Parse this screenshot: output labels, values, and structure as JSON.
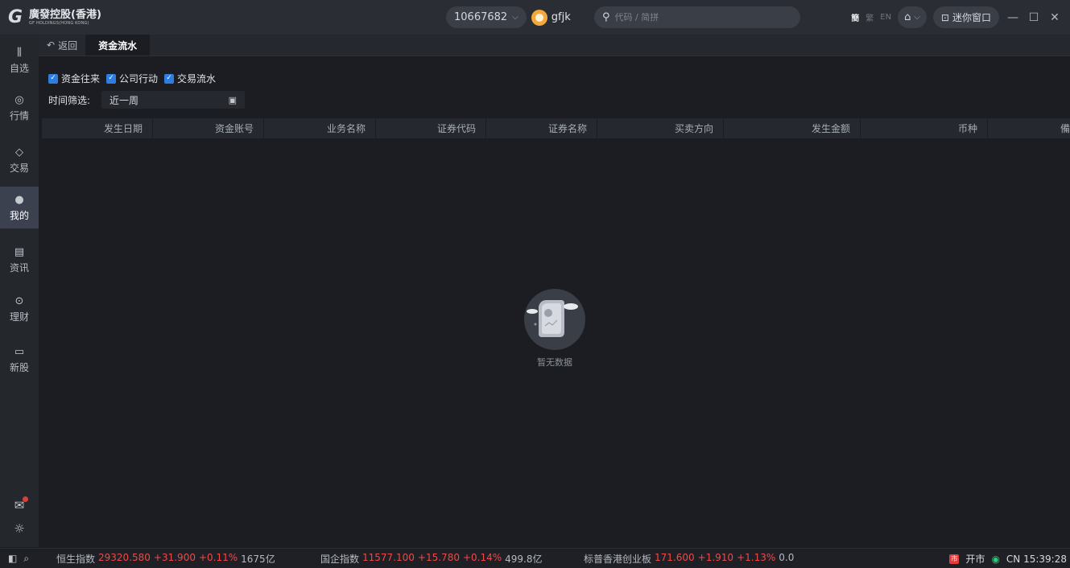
{
  "titlebar": {
    "logo_cn": "廣發控股(香港)",
    "logo_en": "GF HOLDINGS(HONG KONG)",
    "account": "10667682",
    "username": "gfjk",
    "search_placeholder": "代码 / 简拼",
    "lang_simplified": "簡",
    "lang_traditional": "繁",
    "lang_english": "EN",
    "mini_window": "迷你窗口"
  },
  "sidebar": {
    "items": [
      {
        "label": "自选",
        "icon": "candlestick-icon"
      },
      {
        "label": "行情",
        "icon": "trend-icon"
      },
      {
        "label": "交易",
        "icon": "trade-icon"
      },
      {
        "label": "我的",
        "icon": "user-icon"
      },
      {
        "label": "资讯",
        "icon": "news-icon"
      },
      {
        "label": "理财",
        "icon": "wealth-icon"
      },
      {
        "label": "新股",
        "icon": "ipo-icon"
      }
    ]
  },
  "tabs": {
    "back": "返回",
    "active": "资金流水"
  },
  "filters": {
    "options": [
      "资金往来",
      "公司行动",
      "交易流水"
    ],
    "time_label": "时间筛选:",
    "time_value": "近一周"
  },
  "table": {
    "columns": [
      "发生日期",
      "资金账号",
      "业务名称",
      "证券代码",
      "证券名称",
      "买卖方向",
      "发生金额",
      "币种",
      "備"
    ]
  },
  "empty_state": "暂无数据",
  "statusbar": {
    "indices": [
      {
        "name": "恒生指数",
        "value": "29320.580",
        "change": "+31.900",
        "pct": "+0.11%",
        "volume": "1675亿"
      },
      {
        "name": "国企指数",
        "value": "11577.100",
        "change": "+15.780",
        "pct": "+0.14%",
        "volume": "499.8亿"
      },
      {
        "name": "标普香港创业板",
        "value": "171.600",
        "change": "+1.910",
        "pct": "+1.13%",
        "volume": "0.0"
      }
    ],
    "market_status": "开市",
    "market_badge": "市",
    "clock": "CN 15:39:28"
  },
  "colors": {
    "up": "#f04848",
    "accent": "#2f7de1",
    "bg": "#1b1d22"
  }
}
